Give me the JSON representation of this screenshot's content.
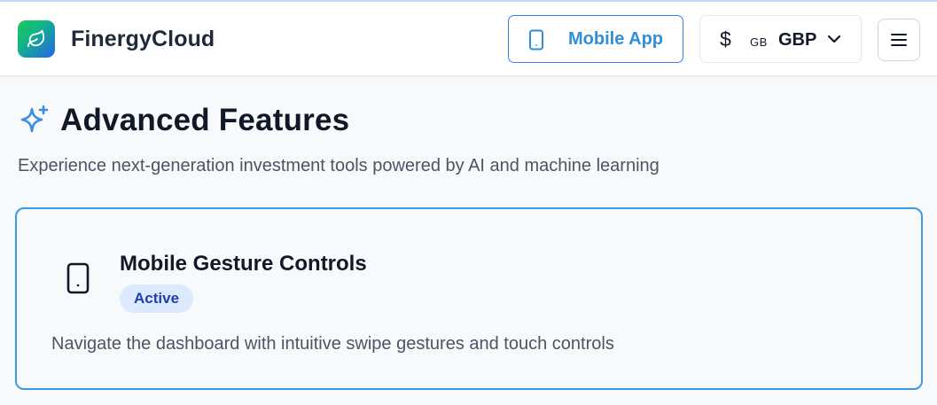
{
  "header": {
    "brand": "FinergyCloud",
    "mobile_app_label": "Mobile App",
    "currency": {
      "symbol": "$",
      "flag": "GB",
      "code": "GBP"
    }
  },
  "page": {
    "title": "Advanced Features",
    "subtitle": "Experience next-generation investment tools powered by AI and machine learning"
  },
  "feature_card": {
    "title": "Mobile Gesture Controls",
    "status": "Active",
    "description": "Navigate the dashboard with intuitive swipe gestures and touch controls"
  },
  "icons": {
    "logo": "leaf-icon",
    "mobile": "smartphone-icon",
    "currency_chevron": "chevron-down-icon",
    "menu": "hamburger-menu-icon",
    "title": "sparkles-icon",
    "feature": "smartphone-icon"
  },
  "colors": {
    "accent": "#2f8fd8",
    "badge_bg": "#dbeafe",
    "badge_text": "#1e40af",
    "card_border": "#3b9ae1"
  }
}
